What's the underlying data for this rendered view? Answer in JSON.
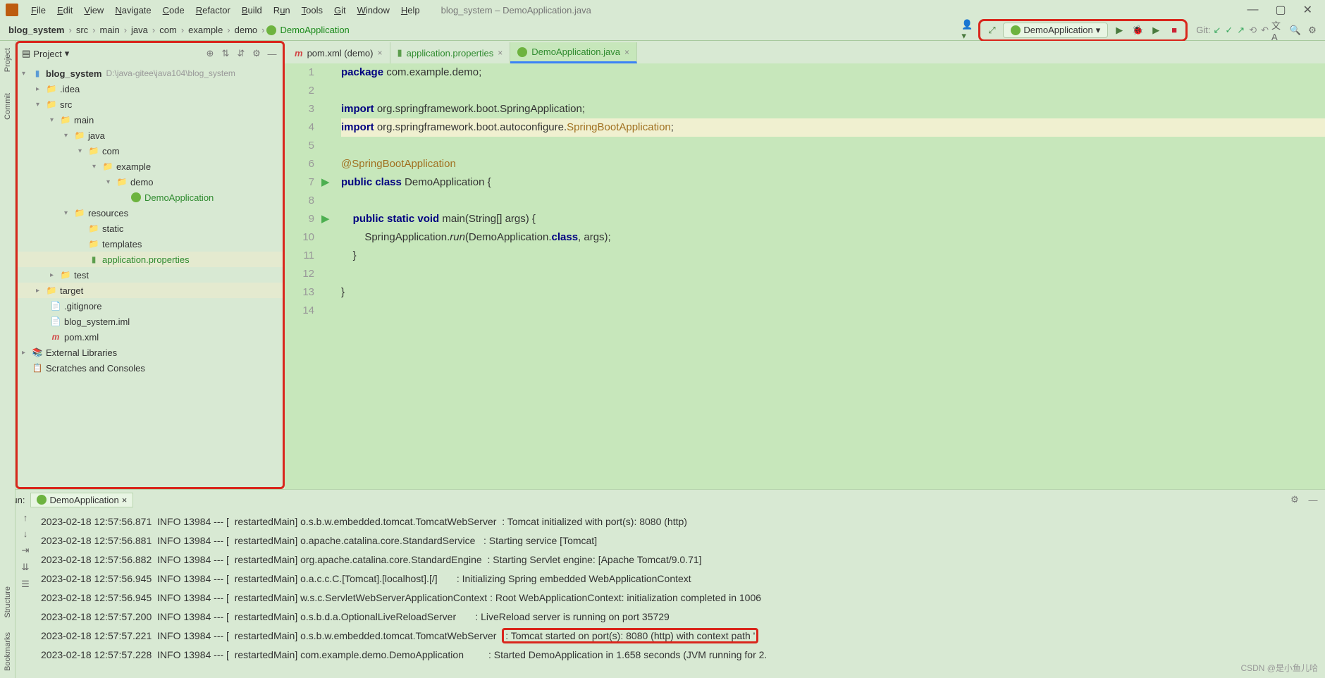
{
  "menu": {
    "items": [
      "File",
      "Edit",
      "View",
      "Navigate",
      "Code",
      "Refactor",
      "Build",
      "Run",
      "Tools",
      "Git",
      "Window",
      "Help"
    ],
    "context": "blog_system – DemoApplication.java"
  },
  "breadcrumbs": [
    "blog_system",
    "src",
    "main",
    "java",
    "com",
    "example",
    "demo",
    "DemoApplication"
  ],
  "run_config": "DemoApplication",
  "git_label": "Git:",
  "project": {
    "title": "Project",
    "root": {
      "name": "blog_system",
      "path": "D:\\java-gitee\\java104\\blog_system"
    },
    "idea": ".idea",
    "src": "src",
    "main": "main",
    "java": "java",
    "com": "com",
    "example": "example",
    "demo": "demo",
    "demoapp": "DemoApplication",
    "resources": "resources",
    "static": "static",
    "templates": "templates",
    "appprops": "application.properties",
    "test": "test",
    "target": "target",
    "gitignore": ".gitignore",
    "iml": "blog_system.iml",
    "pom": "pom.xml",
    "extlib": "External Libraries",
    "scratches": "Scratches and Consoles"
  },
  "tabs": {
    "pom": "pom.xml (demo)",
    "appprops": "application.properties",
    "demoapp": "DemoApplication.java"
  },
  "code": {
    "lines": [
      "1",
      "2",
      "3",
      "4",
      "5",
      "6",
      "7",
      "8",
      "9",
      "10",
      "11",
      "12",
      "13",
      "14"
    ],
    "l1": "package com.example.demo;",
    "l3": "import org.springframework.boot.SpringApplication;",
    "l4": "import org.springframework.boot.autoconfigure.SpringBootApplication;",
    "l6": "@SpringBootApplication",
    "l7": "public class DemoApplication {",
    "l9": "    public static void main(String[] args) {",
    "l10": "        SpringApplication.run(DemoApplication.class, args);",
    "l11": "    }",
    "l13": "}"
  },
  "run": {
    "label": "Run:",
    "tab": "DemoApplication",
    "logs": [
      "2023-02-18 12:57:56.871  INFO 13984 --- [  restartedMain] o.s.b.w.embedded.tomcat.TomcatWebServer  : Tomcat initialized with port(s): 8080 (http)",
      "2023-02-18 12:57:56.881  INFO 13984 --- [  restartedMain] o.apache.catalina.core.StandardService   : Starting service [Tomcat]",
      "2023-02-18 12:57:56.882  INFO 13984 --- [  restartedMain] org.apache.catalina.core.StandardEngine  : Starting Servlet engine: [Apache Tomcat/9.0.71]",
      "2023-02-18 12:57:56.945  INFO 13984 --- [  restartedMain] o.a.c.c.C.[Tomcat].[localhost].[/]       : Initializing Spring embedded WebApplicationContext",
      "2023-02-18 12:57:56.945  INFO 13984 --- [  restartedMain] w.s.c.ServletWebServerApplicationContext : Root WebApplicationContext: initialization completed in 1006",
      "2023-02-18 12:57:57.200  INFO 13984 --- [  restartedMain] o.s.b.d.a.OptionalLiveReloadServer       : LiveReload server is running on port 35729",
      "2023-02-18 12:57:57.221  INFO 13984 --- [  restartedMain] o.s.b.w.embedded.tomcat.TomcatWebServer  ",
      ": Tomcat started on port(s): 8080 (http) with context path '",
      "2023-02-18 12:57:57.228  INFO 13984 --- [  restartedMain] com.example.demo.DemoApplication         : Started DemoApplication in 1.658 seconds (JVM running for 2."
    ]
  },
  "side": {
    "project": "Project",
    "commit": "Commit",
    "structure": "Structure",
    "bookmarks": "Bookmarks"
  },
  "watermark": "CSDN @是小鱼儿哈"
}
